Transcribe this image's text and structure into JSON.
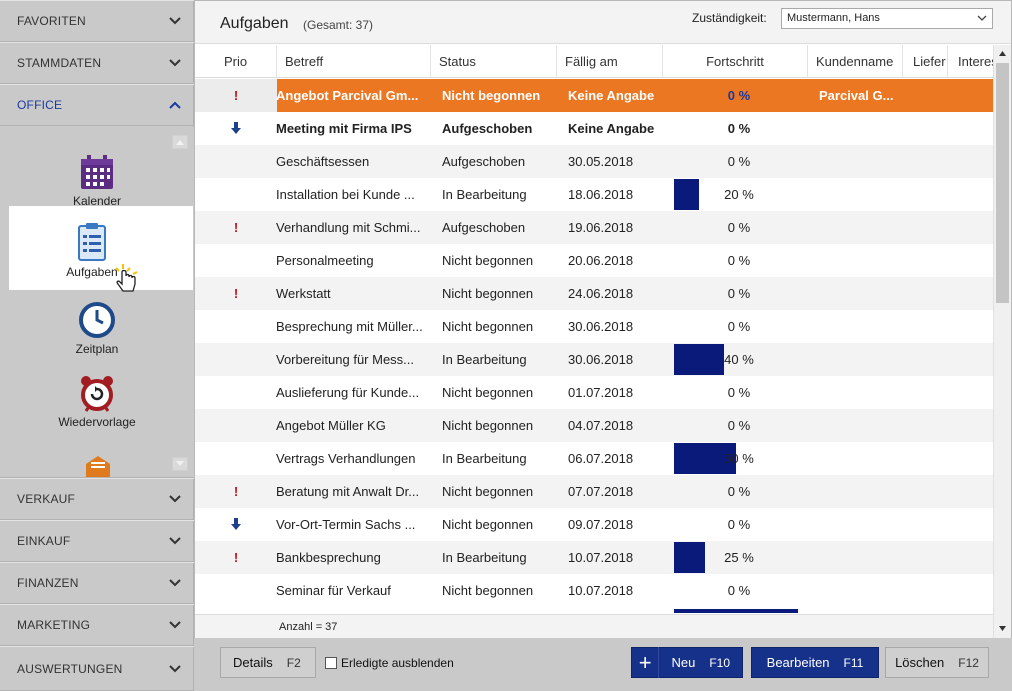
{
  "sidebar": {
    "sections_top": [
      {
        "label": "FAVORITEN",
        "name": "sidebar-section-favoriten"
      },
      {
        "label": "STAMMDATEN",
        "name": "sidebar-section-stammdaten"
      },
      {
        "label": "OFFICE",
        "name": "sidebar-section-office"
      }
    ],
    "office_items": [
      {
        "label": "Kalender",
        "icon": "calendar-icon"
      },
      {
        "label": "Aufgaben",
        "icon": "clipboard-list-icon"
      },
      {
        "label": "Zeitplan",
        "icon": "clock-icon"
      },
      {
        "label": "Wiedervorlage",
        "icon": "alarm-clock-icon"
      }
    ],
    "sections_bottom": [
      {
        "label": "VERKAUF"
      },
      {
        "label": "EINKAUF"
      },
      {
        "label": "FINANZEN"
      },
      {
        "label": "MARKETING"
      },
      {
        "label": "AUSWERTUNGEN"
      }
    ]
  },
  "header": {
    "title": "Aufgaben",
    "total": "(Gesamt: 37)",
    "responsibility_label": "Zuständigkeit:",
    "responsibility_value": "Mustermann, Hans"
  },
  "columns": [
    "Prio",
    "Betreff",
    "Status",
    "Fällig am",
    "Fortschritt",
    "Kundenname",
    "Liefer",
    "Interes"
  ],
  "rows": [
    {
      "prio": "!",
      "betreff": "Angebot Parcival Gm...",
      "status": "Nicht begonnen",
      "faellig": "Keine Angabe",
      "progress": 0,
      "progress_label": "0 %",
      "kunde": "Parcival G..."
    },
    {
      "prio": "down",
      "betreff": "Meeting mit Firma IPS",
      "status": "Aufgeschoben",
      "faellig": "Keine Angabe",
      "progress": 0,
      "progress_label": "0 %",
      "kunde": ""
    },
    {
      "prio": "",
      "betreff": "Geschäftsessen",
      "status": "Aufgeschoben",
      "faellig": "30.05.2018",
      "progress": 0,
      "progress_label": "0 %",
      "kunde": ""
    },
    {
      "prio": "",
      "betreff": "Installation bei Kunde ...",
      "status": "In Bearbeitung",
      "faellig": "18.06.2018",
      "progress": 20,
      "progress_label": "20 %",
      "kunde": ""
    },
    {
      "prio": "!",
      "betreff": "Verhandlung mit Schmi...",
      "status": "Aufgeschoben",
      "faellig": "19.06.2018",
      "progress": 0,
      "progress_label": "0 %",
      "kunde": ""
    },
    {
      "prio": "",
      "betreff": "Personalmeeting",
      "status": "Nicht begonnen",
      "faellig": "20.06.2018",
      "progress": 0,
      "progress_label": "0 %",
      "kunde": ""
    },
    {
      "prio": "!",
      "betreff": "Werkstatt",
      "status": "Nicht begonnen",
      "faellig": "24.06.2018",
      "progress": 0,
      "progress_label": "0 %",
      "kunde": ""
    },
    {
      "prio": "",
      "betreff": "Besprechung mit Müller...",
      "status": "Nicht begonnen",
      "faellig": "30.06.2018",
      "progress": 0,
      "progress_label": "0 %",
      "kunde": ""
    },
    {
      "prio": "",
      "betreff": "Vorbereitung für Mess...",
      "status": "In Bearbeitung",
      "faellig": "30.06.2018",
      "progress": 40,
      "progress_label": "40 %",
      "kunde": ""
    },
    {
      "prio": "",
      "betreff": "Auslieferung für Kunde...",
      "status": "Nicht begonnen",
      "faellig": "01.07.2018",
      "progress": 0,
      "progress_label": "0 %",
      "kunde": ""
    },
    {
      "prio": "",
      "betreff": "Angebot Müller KG",
      "status": "Nicht begonnen",
      "faellig": "04.07.2018",
      "progress": 0,
      "progress_label": "0 %",
      "kunde": ""
    },
    {
      "prio": "",
      "betreff": "Vertrags Verhandlungen",
      "status": "In Bearbeitung",
      "faellig": "06.07.2018",
      "progress": 50,
      "progress_label": "50 %",
      "kunde": ""
    },
    {
      "prio": "!",
      "betreff": "Beratung mit Anwalt Dr...",
      "status": "Nicht begonnen",
      "faellig": "07.07.2018",
      "progress": 0,
      "progress_label": "0 %",
      "kunde": ""
    },
    {
      "prio": "down",
      "betreff": "Vor-Ort-Termin Sachs ...",
      "status": "Nicht begonnen",
      "faellig": "09.07.2018",
      "progress": 0,
      "progress_label": "0 %",
      "kunde": ""
    },
    {
      "prio": "!",
      "betreff": "Bankbesprechung",
      "status": "In Bearbeitung",
      "faellig": "10.07.2018",
      "progress": 25,
      "progress_label": "25 %",
      "kunde": ""
    },
    {
      "prio": "",
      "betreff": "Seminar für Verkauf",
      "status": "Nicht begonnen",
      "faellig": "10.07.2018",
      "progress": 0,
      "progress_label": "0 %",
      "kunde": ""
    }
  ],
  "footer": {
    "count": "Anzahl = 37"
  },
  "toolbar": {
    "details": "Details",
    "details_key": "F2",
    "hide_done": "Erledigte ausblenden",
    "new": "Neu",
    "new_key": "F10",
    "edit": "Bearbeiten",
    "edit_key": "F11",
    "delete": "Löschen",
    "delete_key": "F12"
  },
  "colors": {
    "selected_row": "#ec7723",
    "progress_bar": "#0a1a7a",
    "primary_button": "#16318a",
    "priority_high": "#c0121b"
  }
}
